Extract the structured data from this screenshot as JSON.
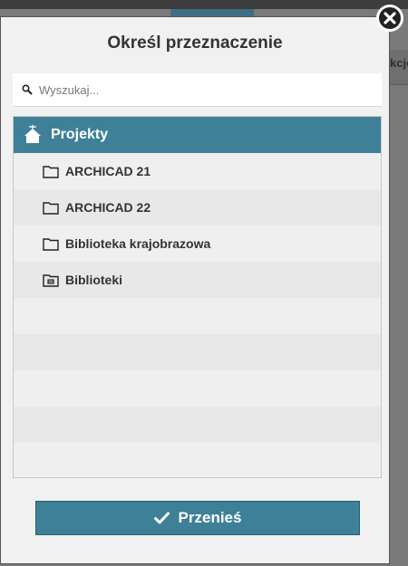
{
  "modal": {
    "title": "Określ przeznaczenie",
    "search": {
      "placeholder": "Wyszukaj...",
      "value": ""
    },
    "tree": {
      "root": {
        "label": "Projekty",
        "icon": "home-icon"
      },
      "items": [
        {
          "label": "ARCHICAD 21",
          "icon": "folder-icon"
        },
        {
          "label": "ARCHICAD 22",
          "icon": "folder-icon"
        },
        {
          "label": "Biblioteka krajobrazowa",
          "icon": "folder-icon"
        },
        {
          "label": "Biblioteki",
          "icon": "library-folder-icon"
        }
      ]
    },
    "move_button_label": "Przenieś",
    "close_icon": "close-icon"
  },
  "backdrop": {
    "partial_text": "kcję"
  },
  "colors": {
    "accent": "#3e8098",
    "modal_bg": "#f1f1f1",
    "backdrop": "#7a7a7a"
  }
}
